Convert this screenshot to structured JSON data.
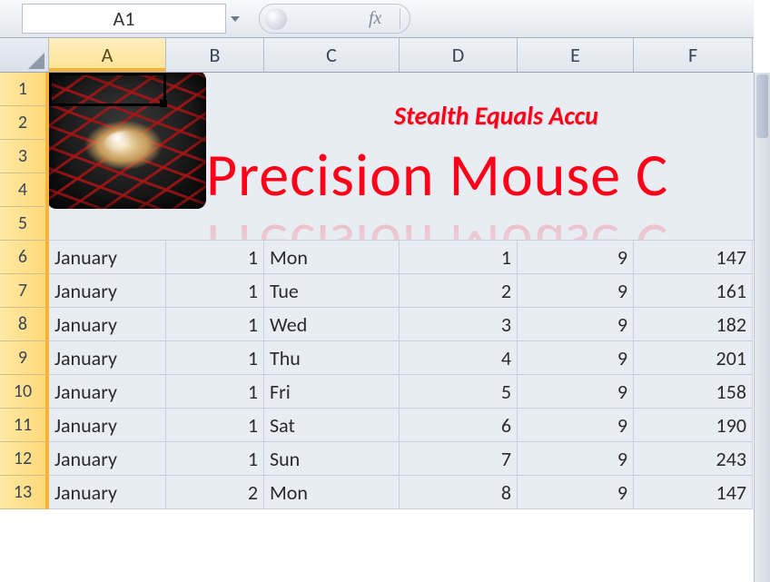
{
  "namebox": {
    "value": "A1"
  },
  "fxlabel": "fx",
  "formula": "",
  "columns": [
    "A",
    "B",
    "C",
    "D",
    "E",
    "F"
  ],
  "row_heads": [
    1,
    2,
    3,
    4,
    5,
    6,
    7,
    8,
    9,
    10,
    11,
    12,
    13
  ],
  "title": {
    "tagline": "Stealth Equals Accu",
    "main": "Precision Mouse C"
  },
  "rows": [
    {
      "A": "January",
      "B": 1,
      "C": "Mon",
      "D": 1,
      "E": 9,
      "F": 147
    },
    {
      "A": "January",
      "B": 1,
      "C": "Tue",
      "D": 2,
      "E": 9,
      "F": 161
    },
    {
      "A": "January",
      "B": 1,
      "C": "Wed",
      "D": 3,
      "E": 9,
      "F": 182
    },
    {
      "A": "January",
      "B": 1,
      "C": "Thu",
      "D": 4,
      "E": 9,
      "F": 201
    },
    {
      "A": "January",
      "B": 1,
      "C": "Fri",
      "D": 5,
      "E": 9,
      "F": 158
    },
    {
      "A": "January",
      "B": 1,
      "C": "Sat",
      "D": 6,
      "E": 9,
      "F": 190
    },
    {
      "A": "January",
      "B": 1,
      "C": "Sun",
      "D": 7,
      "E": 9,
      "F": 243
    },
    {
      "A": "January",
      "B": 2,
      "C": "Mon",
      "D": 8,
      "E": 9,
      "F": 147
    }
  ]
}
